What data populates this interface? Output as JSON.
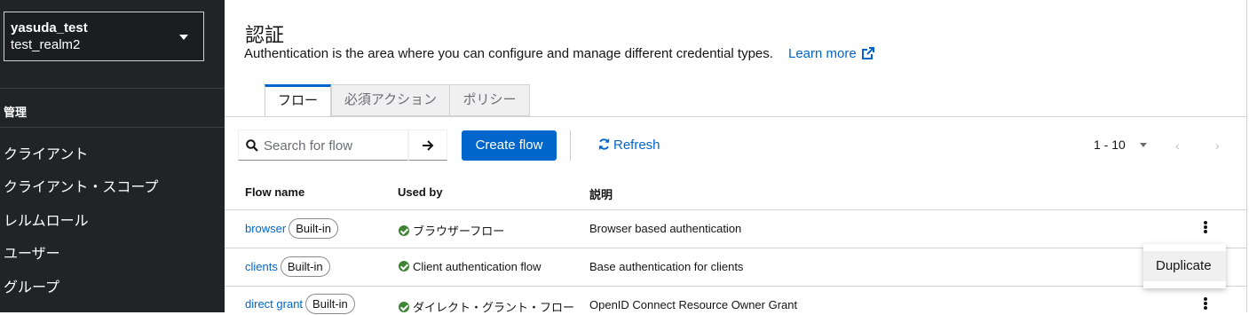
{
  "sidebar": {
    "realm_name": "yasuda_test",
    "realm_sub": "test_realm2",
    "section": "管理",
    "items": [
      {
        "label": "クライアント"
      },
      {
        "label": "クライアント・スコープ"
      },
      {
        "label": "レルムロール"
      },
      {
        "label": "ユーザー"
      },
      {
        "label": "グループ"
      }
    ]
  },
  "header": {
    "title": "認証",
    "description": "Authentication is the area where you can configure and manage different credential types.",
    "learn_more": "Learn more"
  },
  "tabs": [
    {
      "label": "フロー",
      "active": true
    },
    {
      "label": "必須アクション",
      "active": false
    },
    {
      "label": "ポリシー",
      "active": false
    }
  ],
  "toolbar": {
    "search_placeholder": "Search for flow",
    "search_value": "",
    "create_label": "Create flow",
    "refresh_label": "Refresh",
    "pagination": "1 - 10"
  },
  "table": {
    "columns": [
      "Flow name",
      "Used by",
      "説明"
    ],
    "rows": [
      {
        "name": "browser",
        "badge": "Built-in",
        "used_by": "ブラウザーフロー",
        "description": "Browser based authentication"
      },
      {
        "name": "clients",
        "badge": "Built-in",
        "used_by": "Client authentication flow",
        "description": "Base authentication for clients"
      },
      {
        "name": "direct grant",
        "badge": "Built-in",
        "used_by": "ダイレクト・グラント・フロー",
        "description": "OpenID Connect Resource Owner Grant"
      }
    ]
  },
  "row_menu": {
    "items": [
      {
        "label": "Duplicate"
      }
    ]
  },
  "colors": {
    "accent": "#0066cc",
    "sidebar_bg": "#212427",
    "success": "#3e8635"
  }
}
